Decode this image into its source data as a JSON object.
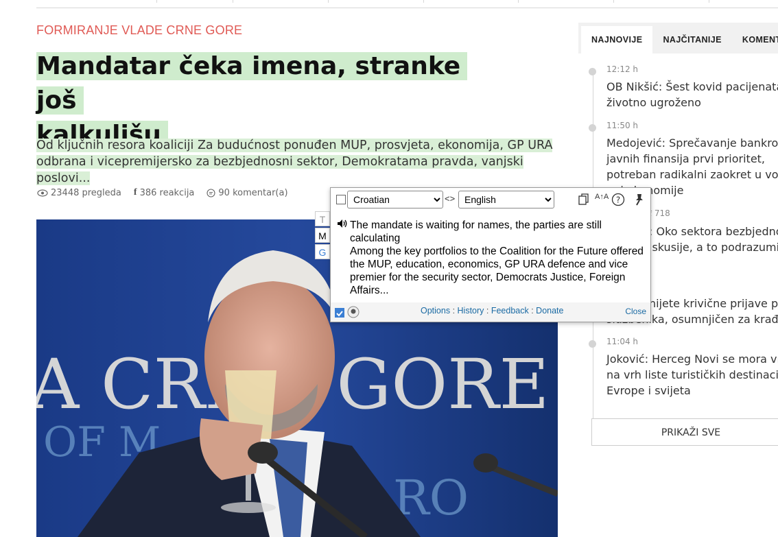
{
  "article": {
    "category": "FORMIRANJE VLADE CRNE GORE",
    "headline_line1": "Mandatar čeka imena, stranke još",
    "headline_line2": "kalkulišu",
    "lead": "Od ključnih resora koaliciji Za budućnost ponuđen MUP, prosvjeta, ekonomija, GP URA odbrana i vicepremijersko za bezbjednosni sektor, Demokratama pravda, vanjski poslovi...",
    "views": "23448 pregleda",
    "reactions": "386 reakcija",
    "comments": "90 komentar(a)",
    "photo_sign_text": "A CRNA GORE"
  },
  "sidebar": {
    "tabs": [
      "NAJNOVIJE",
      "NAJČITANIJE",
      "KOMENT"
    ],
    "items": [
      {
        "time": "12:12 h",
        "lines": [
          "OB Nikšić: Šest kovid pacijenata",
          "životno ugroženo"
        ]
      },
      {
        "time": "11:50 h",
        "lines": [
          "Medojević: Sprečavanje bankrota",
          "javnih finansija prvi prioritet,",
          "potreban radikalni zaokret u vođe",
          "...  i ekonomije"
        ]
      },
      {
        "time": "",
        "extra": "718",
        "lines": [
          ": Oko sektora bezbjednos",
          "iskusije, a to podrazumijev"
        ]
      },
      {
        "time": "",
        "lines": [
          "nijete krivične prijave prot",
          "sluzbenika, osumnjičen za krađe"
        ]
      },
      {
        "time": "11:04 h",
        "lines": [
          "Joković: Herceg Novi se mora vrat",
          "na vrh liste turističkih destinacija",
          "Evrope i svijeta"
        ]
      }
    ],
    "show_all": "PRIKAŽI SVE"
  },
  "translator": {
    "source_lang": "Croatian",
    "target_lang": "English",
    "swap_icon": "<>",
    "translation_title": "The mandate is waiting for names, the parties are still calculating",
    "translation_body": "Among the key portfolios to the Coalition for the Future offered the MUP, education, economics, GP URA defence and vice premier for the security sector, Democrats Justice, Foreign Affairs...",
    "links": [
      "Options",
      "History",
      "Feedback",
      "Donate"
    ],
    "close": "Close",
    "side_tabs": [
      "T",
      "M",
      "G"
    ]
  },
  "colors": {
    "category": "#e05a55",
    "highlight": "#cfeccd",
    "link": "#1a6aa3"
  }
}
